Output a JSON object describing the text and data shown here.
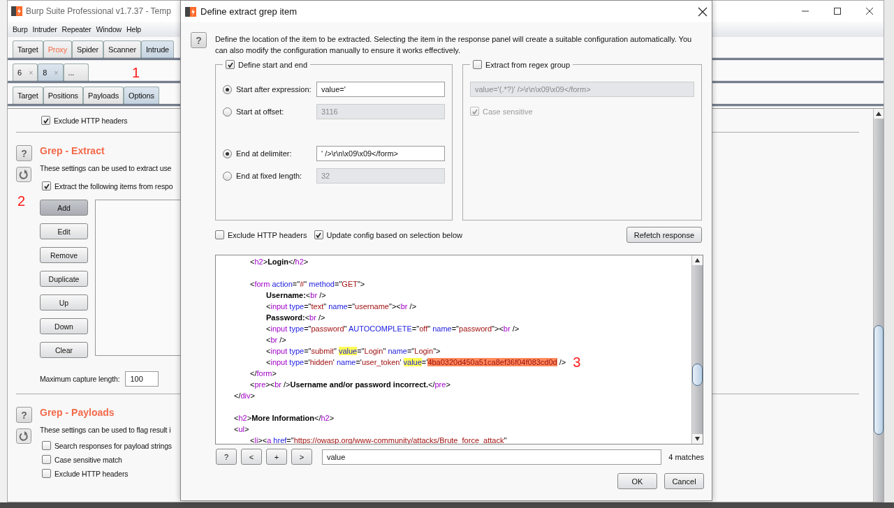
{
  "main_window": {
    "title": "Burp Suite Professional v1.7.37 - Temp",
    "menu": [
      "Burp",
      "Intruder",
      "Repeater",
      "Window",
      "Help"
    ],
    "tabs": [
      {
        "label": "Target",
        "selected": false,
        "highlighted": false
      },
      {
        "label": "Proxy",
        "selected": false,
        "highlighted": true
      },
      {
        "label": "Spider",
        "selected": false,
        "highlighted": false
      },
      {
        "label": "Scanner",
        "selected": false,
        "highlighted": false
      },
      {
        "label": "Intrude",
        "selected": true,
        "highlighted": false
      }
    ],
    "attack_tabs": [
      {
        "label": "6",
        "close": "×",
        "selected": false
      },
      {
        "label": "8",
        "close": "×",
        "selected": true
      },
      {
        "label": "...",
        "selected": false
      }
    ],
    "annotation": "1",
    "intruder_tabs": [
      {
        "label": "Target",
        "selected": false
      },
      {
        "label": "Positions",
        "selected": false
      },
      {
        "label": "Payloads",
        "selected": false
      },
      {
        "label": "Options",
        "selected": true
      }
    ],
    "exclude_headers": {
      "label": "Exclude HTTP headers",
      "checked": true
    },
    "grep_extract": {
      "help": "?",
      "title": "Grep - Extract",
      "description": "These settings can be used to extract use",
      "annotation": "2",
      "extract": {
        "label": "Extract the following items from respo",
        "checked": true
      },
      "buttons": [
        {
          "label": "Add",
          "pressed": true
        },
        {
          "label": "Edit",
          "pressed": false
        },
        {
          "label": "Remove",
          "pressed": false
        },
        {
          "label": "Duplicate",
          "pressed": false
        },
        {
          "label": "Up",
          "pressed": false
        },
        {
          "label": "Down",
          "pressed": false
        },
        {
          "label": "Clear",
          "pressed": false
        }
      ],
      "max_length_label": "Maximum capture length:",
      "max_length": "100"
    },
    "grep_payloads": {
      "help": "?",
      "title": "Grep - Payloads",
      "description": "These settings can be used to flag result i",
      "checkboxes": [
        {
          "label": "Search responses for payload strings",
          "checked": false
        },
        {
          "label": "Case sensitive match",
          "checked": false
        },
        {
          "label": "Exclude HTTP headers",
          "checked": false
        }
      ]
    }
  },
  "dialog": {
    "title": "Define extract grep item",
    "help": "?",
    "description": "Define the location of the item to be extracted. Selecting the item in the response panel will create a suitable configuration automatically. You can also modify the configuration manually to ensure it works effectively.",
    "start_end": {
      "label": "Define start and end",
      "checked": true,
      "start": [
        {
          "label": "Start after expression:",
          "selected": true,
          "value": "value='",
          "disabled": false
        },
        {
          "label": "Start at offset:",
          "selected": false,
          "value": "3116",
          "disabled": true
        }
      ],
      "end": [
        {
          "label": "End at delimiter:",
          "selected": true,
          "value": "' />\\r\\n\\x09\\x09</form>",
          "disabled": false
        },
        {
          "label": "End at fixed length:",
          "selected": false,
          "value": "32",
          "disabled": true
        }
      ]
    },
    "regex": {
      "label": "Extract from regex group",
      "checked": false,
      "value": "value='(.*?)' />\\r\\n\\x09\\x09</form>",
      "disabled": true,
      "case": {
        "label": "Case sensitive",
        "checked": true,
        "disabled": true
      }
    },
    "options": [
      {
        "label": "Exclude HTTP headers",
        "checked": false
      },
      {
        "label": "Update config based on selection below",
        "checked": true
      }
    ],
    "refetch": "Refetch response",
    "code": [
      {
        "kind": "code",
        "tokens": [
          {
            "kind": "punct",
            "text": "\t<"
          },
          {
            "kind": "tag",
            "text": "h2"
          },
          {
            "kind": "punct",
            "text": ">"
          },
          {
            "kind": "text",
            "text": "Login"
          },
          {
            "kind": "punct",
            "text": "</"
          },
          {
            "kind": "tag",
            "text": "h2"
          },
          {
            "kind": "punct",
            "text": ">"
          }
        ]
      },
      {
        "kind": "blank"
      },
      {
        "kind": "code",
        "tokens": [
          {
            "kind": "punct",
            "text": "\t<"
          },
          {
            "kind": "tag",
            "text": "form"
          },
          {
            "kind": "attr",
            "text": " action"
          },
          {
            "kind": "punct",
            "text": "=\""
          },
          {
            "kind": "val",
            "text": "#"
          },
          {
            "kind": "punct",
            "text": "\""
          },
          {
            "kind": "attr",
            "text": " method"
          },
          {
            "kind": "punct",
            "text": "=\""
          },
          {
            "kind": "val",
            "text": "GET"
          },
          {
            "kind": "punct",
            "text": "\">"
          }
        ]
      },
      {
        "kind": "code",
        "tokens": [
          {
            "kind": "text",
            "text": "\t\tUsername:"
          },
          {
            "kind": "punct",
            "text": "<"
          },
          {
            "kind": "tag",
            "text": "br"
          },
          {
            "kind": "punct",
            "text": " />"
          }
        ]
      },
      {
        "kind": "code",
        "tokens": [
          {
            "kind": "punct",
            "text": "\t\t<"
          },
          {
            "kind": "tag",
            "text": "input"
          },
          {
            "kind": "attr",
            "text": " type"
          },
          {
            "kind": "punct",
            "text": "=\""
          },
          {
            "kind": "val",
            "text": "text"
          },
          {
            "kind": "punct",
            "text": "\""
          },
          {
            "kind": "attr",
            "text": " name"
          },
          {
            "kind": "punct",
            "text": "=\""
          },
          {
            "kind": "val",
            "text": "username"
          },
          {
            "kind": "punct",
            "text": "\"><"
          },
          {
            "kind": "tag",
            "text": "br"
          },
          {
            "kind": "punct",
            "text": " />"
          }
        ]
      },
      {
        "kind": "code",
        "tokens": [
          {
            "kind": "text",
            "text": "\t\tPassword:"
          },
          {
            "kind": "punct",
            "text": "<"
          },
          {
            "kind": "tag",
            "text": "br"
          },
          {
            "kind": "punct",
            "text": " />"
          }
        ]
      },
      {
        "kind": "code",
        "tokens": [
          {
            "kind": "punct",
            "text": "\t\t<"
          },
          {
            "kind": "tag",
            "text": "input"
          },
          {
            "kind": "attr",
            "text": " type"
          },
          {
            "kind": "punct",
            "text": "=\""
          },
          {
            "kind": "val",
            "text": "password"
          },
          {
            "kind": "punct",
            "text": "\""
          },
          {
            "kind": "attr",
            "text": " AUTOCOMPLETE"
          },
          {
            "kind": "punct",
            "text": "=\""
          },
          {
            "kind": "val",
            "text": "off"
          },
          {
            "kind": "punct",
            "text": "\""
          },
          {
            "kind": "attr",
            "text": " name"
          },
          {
            "kind": "punct",
            "text": "=\""
          },
          {
            "kind": "val",
            "text": "password"
          },
          {
            "kind": "punct",
            "text": "\"><"
          },
          {
            "kind": "tag",
            "text": "br"
          },
          {
            "kind": "punct",
            "text": " />"
          }
        ]
      },
      {
        "kind": "code",
        "tokens": [
          {
            "kind": "punct",
            "text": "\t\t<"
          },
          {
            "kind": "tag",
            "text": "br"
          },
          {
            "kind": "punct",
            "text": " />"
          }
        ]
      },
      {
        "kind": "code",
        "tokens": [
          {
            "kind": "punct",
            "text": "\t\t<"
          },
          {
            "kind": "tag",
            "text": "input"
          },
          {
            "kind": "attr",
            "text": " type"
          },
          {
            "kind": "punct",
            "text": "=\""
          },
          {
            "kind": "val",
            "text": "submit"
          },
          {
            "kind": "punct",
            "text": "\" "
          },
          {
            "kind": "attr",
            "text": "value",
            "highlighted": true
          },
          {
            "kind": "punct",
            "text": "=\""
          },
          {
            "kind": "val",
            "text": "Login"
          },
          {
            "kind": "punct",
            "text": "\""
          },
          {
            "kind": "attr",
            "text": " name"
          },
          {
            "kind": "punct",
            "text": "=\""
          },
          {
            "kind": "val",
            "text": "Login"
          },
          {
            "kind": "punct",
            "text": "\">"
          }
        ]
      },
      {
        "kind": "code",
        "annotation": "3",
        "tokens": [
          {
            "kind": "punct",
            "text": "\t\t<"
          },
          {
            "kind": "tag",
            "text": "input"
          },
          {
            "kind": "attr",
            "text": " type"
          },
          {
            "kind": "punct",
            "text": "='"
          },
          {
            "kind": "val",
            "text": "hidden"
          },
          {
            "kind": "punct",
            "text": "'"
          },
          {
            "kind": "attr",
            "text": " name"
          },
          {
            "kind": "punct",
            "text": "='"
          },
          {
            "kind": "val",
            "text": "user_token"
          },
          {
            "kind": "punct",
            "text": "' "
          },
          {
            "kind": "attr",
            "text": "value",
            "highlighted": true
          },
          {
            "kind": "punct",
            "text": "='"
          },
          {
            "kind": "val",
            "text": "4ba0320d450a51ca8ef36f04f083cd0d",
            "selected": true
          },
          {
            "kind": "punct",
            "text": " />"
          }
        ]
      },
      {
        "kind": "code",
        "tokens": [
          {
            "kind": "punct",
            "text": "\t</"
          },
          {
            "kind": "tag",
            "text": "form"
          },
          {
            "kind": "punct",
            "text": ">"
          }
        ]
      },
      {
        "kind": "code",
        "tokens": [
          {
            "kind": "punct",
            "text": "\t<"
          },
          {
            "kind": "tag",
            "text": "pre"
          },
          {
            "kind": "punct",
            "text": "><"
          },
          {
            "kind": "tag",
            "text": "br"
          },
          {
            "kind": "punct",
            "text": " />"
          },
          {
            "kind": "text",
            "text": "Username and/or password incorrect."
          },
          {
            "kind": "punct",
            "text": "</"
          },
          {
            "kind": "tag",
            "text": "pre"
          },
          {
            "kind": "punct",
            "text": ">"
          }
        ]
      },
      {
        "kind": "code",
        "tokens": [
          {
            "kind": "punct",
            "text": "</"
          },
          {
            "kind": "tag",
            "text": "div"
          },
          {
            "kind": "punct",
            "text": ">"
          }
        ]
      },
      {
        "kind": "blank"
      },
      {
        "kind": "code",
        "tokens": [
          {
            "kind": "punct",
            "text": "<"
          },
          {
            "kind": "tag",
            "text": "h2"
          },
          {
            "kind": "punct",
            "text": ">"
          },
          {
            "kind": "text",
            "text": "More Information"
          },
          {
            "kind": "punct",
            "text": "</"
          },
          {
            "kind": "tag",
            "text": "h2"
          },
          {
            "kind": "punct",
            "text": ">"
          }
        ]
      },
      {
        "kind": "code",
        "tokens": [
          {
            "kind": "punct",
            "text": "<"
          },
          {
            "kind": "tag",
            "text": "ul"
          },
          {
            "kind": "punct",
            "text": ">"
          }
        ]
      },
      {
        "kind": "code",
        "tokens": [
          {
            "kind": "punct",
            "text": "\t<"
          },
          {
            "kind": "tag",
            "text": "li"
          },
          {
            "kind": "punct",
            "text": "><"
          },
          {
            "kind": "tag",
            "text": "a"
          },
          {
            "kind": "attr",
            "text": " href"
          },
          {
            "kind": "punct",
            "text": "=\""
          },
          {
            "kind": "val",
            "text": "https://owasp.org/www-community/attacks/Brute_force_attack"
          },
          {
            "kind": "punct",
            "text": "\""
          }
        ]
      }
    ],
    "search_buttons": [
      "?",
      "<",
      "+",
      ">"
    ],
    "search_value": "value",
    "matches": "4 matches",
    "buttons": [
      "OK",
      "Cancel"
    ]
  }
}
